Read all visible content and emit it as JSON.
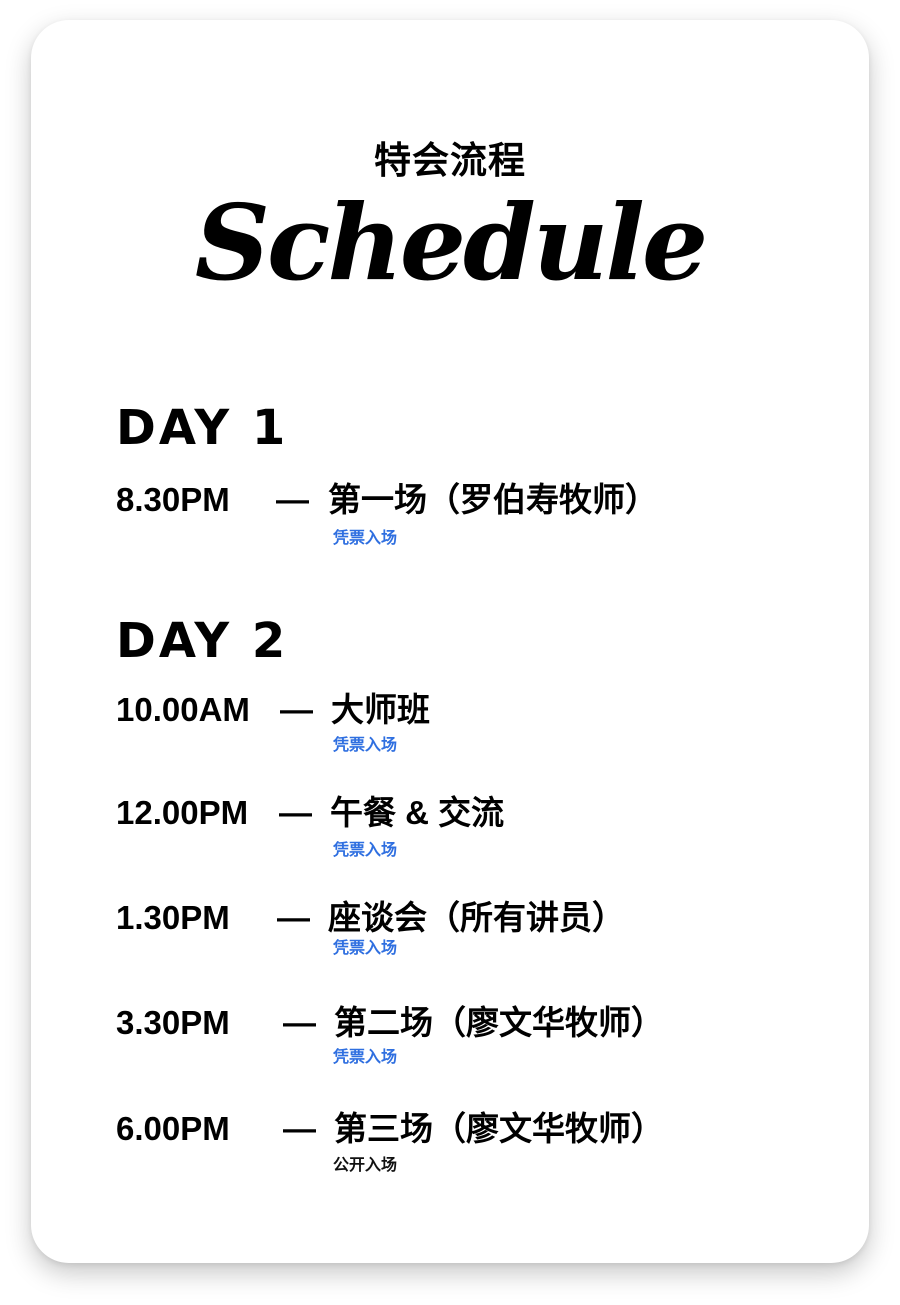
{
  "header": {
    "subtitle": "特会流程",
    "title": "Schedule"
  },
  "days": [
    {
      "label": "DAY 1",
      "items": [
        {
          "time": "8.30PM",
          "dash": "—",
          "event": "第一场（罗伯寿牧师）",
          "note": "凭票入场"
        }
      ]
    },
    {
      "label": "DAY 2",
      "items": [
        {
          "time": "10.00AM",
          "dash": "—",
          "event": "大师班",
          "note": "凭票入场"
        },
        {
          "time": "12.00PM",
          "dash": "—",
          "event": "午餐 & 交流",
          "note": "凭票入场"
        },
        {
          "time": "1.30PM",
          "dash": "—",
          "event": "座谈会（所有讲员）",
          "note": "凭票入场"
        },
        {
          "time": "3.30PM",
          "dash": "—",
          "event": "第二场（廖文华牧师）",
          "note": "凭票入场"
        },
        {
          "time": "6.00PM",
          "dash": "—",
          "event": "第三场（廖文华牧师）",
          "note": "公开入场"
        }
      ]
    }
  ],
  "colors": {
    "ticket_note": "#2f6fe0",
    "open_note": "#111111",
    "text": "#000000"
  }
}
